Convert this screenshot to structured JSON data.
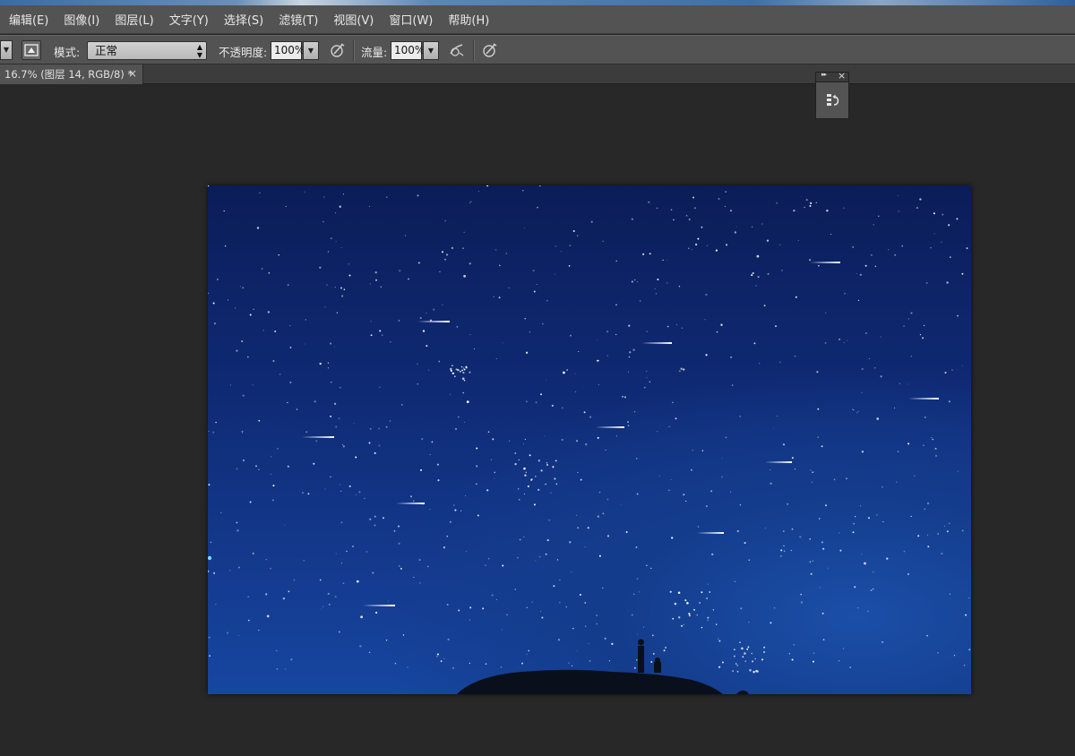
{
  "menu": {
    "items": [
      "编辑(E)",
      "图像(I)",
      "图层(L)",
      "文字(Y)",
      "选择(S)",
      "滤镜(T)",
      "视图(V)",
      "窗口(W)",
      "帮助(H)"
    ]
  },
  "options": {
    "mode_label": "模式:",
    "mode_value": "正常",
    "opacity_label": "不透明度:",
    "opacity_value": "100%",
    "flow_label": "流量:",
    "flow_value": "100%"
  },
  "document_tab": {
    "title": "16.7% (图层 14, RGB/8) *",
    "close_glyph": "×"
  },
  "mini_panel": {
    "expand_glyph": "▸▸",
    "close_glyph": "×"
  },
  "colors": {
    "ui_panel": "#535353",
    "workspace": "#282828",
    "sky_top": "#0b1d58",
    "sky_bottom": "#1646a0"
  }
}
